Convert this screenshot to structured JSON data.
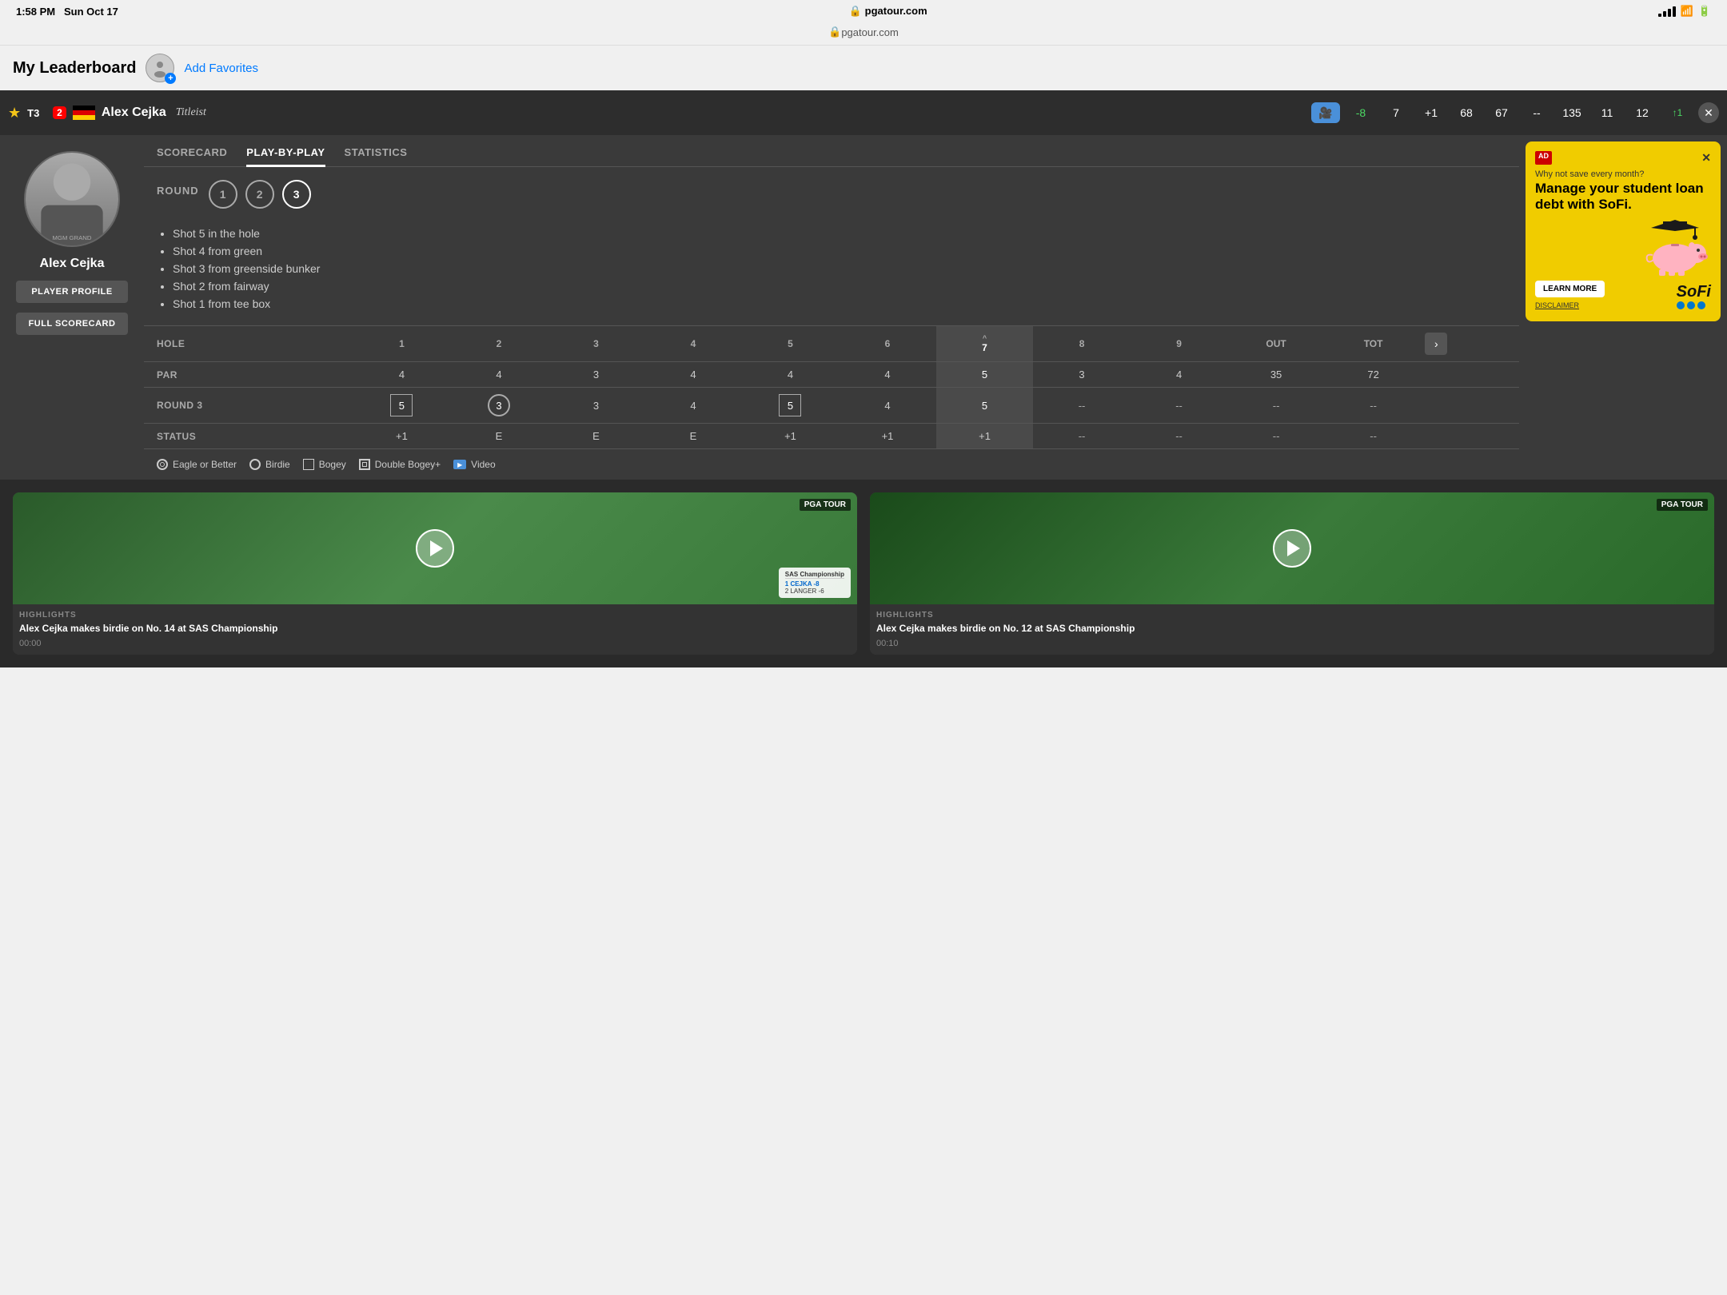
{
  "status_bar": {
    "time": "1:58 PM",
    "day": "Sun Oct 17",
    "url": "pgatour.com",
    "lock_symbol": "🔒"
  },
  "header": {
    "title": "My Leaderboard",
    "add_favorites": "Add Favorites"
  },
  "player_row": {
    "position": "T3",
    "strokes": "2",
    "player_name": "Alex Cejka",
    "sponsor": "Titleist",
    "score": "-8",
    "score_label": "-8",
    "today": "7",
    "thru": "+1",
    "r1": "68",
    "r2": "67",
    "r3": "--",
    "total": "135",
    "holes": "11",
    "round_score": "12",
    "movement": "↑1"
  },
  "tabs": {
    "scorecard": "SCORECARD",
    "play_by_play": "PLAY-BY-PLAY",
    "statistics": "STATISTICS"
  },
  "round_section": {
    "label": "ROUND",
    "rounds": [
      "1",
      "2",
      "3"
    ],
    "active": 2
  },
  "play_by_play": {
    "shots": [
      "Shot 5 in the hole",
      "Shot 4 from green",
      "Shot 3 from greenside bunker",
      "Shot 2 from fairway",
      "Shot 1 from tee box"
    ]
  },
  "scorecard": {
    "hole_header": "HOLE",
    "par_header": "PAR",
    "round3_header": "ROUND 3",
    "status_header": "STATUS",
    "holes": [
      "1",
      "2",
      "3",
      "4",
      "5",
      "6",
      "7",
      "8",
      "9",
      "OUT",
      "TOT"
    ],
    "par": [
      "4",
      "4",
      "3",
      "4",
      "4",
      "4",
      "5",
      "3",
      "4",
      "35",
      "72"
    ],
    "round3": [
      "5",
      "3",
      "3",
      "4",
      "5",
      "4",
      "5",
      "--",
      "--",
      "--",
      "--"
    ],
    "status": [
      "+1",
      "E",
      "E",
      "E",
      "+1",
      "+1",
      "+1",
      "--",
      "--",
      "--",
      "--"
    ],
    "active_hole": 6,
    "hole7_arrow": "^"
  },
  "legend": {
    "eagle": "Eagle or Better",
    "birdie": "Birdie",
    "bogey": "Bogey",
    "double_bogey": "Double Bogey+",
    "video": "Video"
  },
  "ad": {
    "badge": "AD",
    "why_save": "Why not save every month?",
    "headline": "Manage your student loan debt with SoFi.",
    "learn_more": "LEARN MORE",
    "disclaimer": "DISCLAIMER",
    "brand": "SoFi"
  },
  "player_left": {
    "name": "Alex Cejka",
    "player_profile_btn": "PLAYER PROFILE",
    "full_scorecard_btn": "FULL SCORECARD"
  },
  "videos": [
    {
      "label": "HIGHLIGHTS",
      "title": "Alex Cejka makes birdie on No. 14 at SAS Championship",
      "duration": "00:00",
      "pga_badge": "PGA TOUR"
    },
    {
      "label": "HIGHLIGHTS",
      "title": "Alex Cejka makes birdie on No. 12 at SAS Championship",
      "duration": "00:10",
      "pga_badge": "PGA TOUR"
    }
  ]
}
